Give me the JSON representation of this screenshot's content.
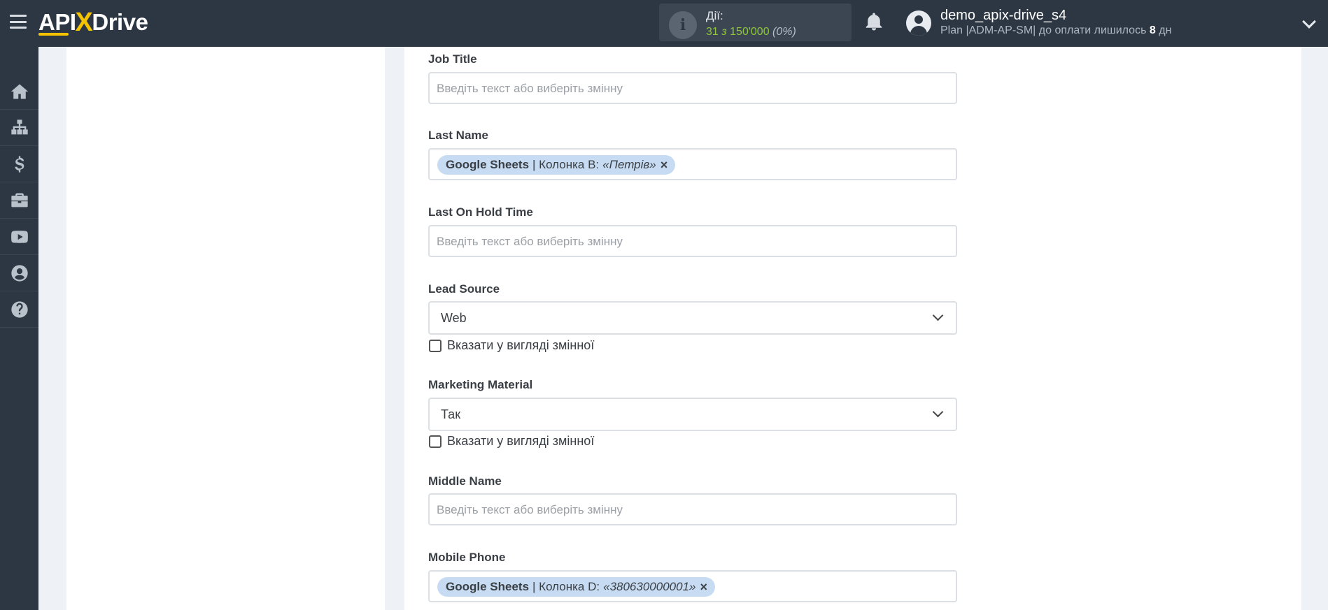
{
  "header": {
    "logo": {
      "part1": "API",
      "part2": "X",
      "part3": "Drive"
    },
    "actions": {
      "label": "Дії:",
      "used": "31",
      "of": "з",
      "total": "150'000",
      "percent": "(0%)"
    },
    "user": {
      "name": "demo_apix-drive_s4",
      "plan_prefix": "Plan |ADM-AP-SM| до оплати лишилось",
      "days": "8",
      "days_unit": "дн"
    }
  },
  "sidebar": {
    "items": [
      {
        "icon": "home-icon"
      },
      {
        "icon": "sitemap-icon"
      },
      {
        "icon": "dollar-icon"
      },
      {
        "icon": "briefcase-icon"
      },
      {
        "icon": "youtube-icon"
      },
      {
        "icon": "user-icon"
      },
      {
        "icon": "help-icon"
      }
    ]
  },
  "form": {
    "placeholder": "Введіть текст або виберіть змінну",
    "checkbox_label": "Вказати у вигляді змінної",
    "job_title": {
      "label": "Job Title"
    },
    "last_name": {
      "label": "Last Name",
      "tag": {
        "source": "Google Sheets",
        "column": "| Колонка B:",
        "value": "«Петрів»",
        "close": "×"
      }
    },
    "last_on_hold_time": {
      "label": "Last On Hold Time"
    },
    "lead_source": {
      "label": "Lead Source",
      "value": "Web"
    },
    "marketing_material": {
      "label": "Marketing Material",
      "value": "Так"
    },
    "middle_name": {
      "label": "Middle Name"
    },
    "mobile_phone": {
      "label": "Mobile Phone",
      "tag": {
        "source": "Google Sheets",
        "column": "| Колонка D:",
        "value": "«380630000001»",
        "close": "×"
      }
    }
  },
  "colors": {
    "topbar": "#2d3744",
    "accent": "#f5c400",
    "count_green": "#8fc63e",
    "tag_bg": "#c7dcf2"
  }
}
